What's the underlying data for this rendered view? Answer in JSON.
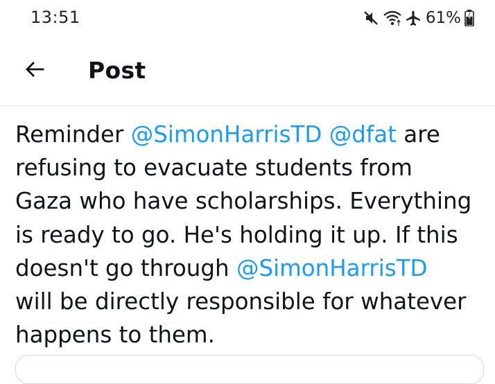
{
  "status_bar": {
    "time": "13:51",
    "battery_percent": "61%",
    "icons": [
      "mute-icon",
      "wifi-icon",
      "airplane-mode-icon",
      "battery-icon"
    ]
  },
  "header": {
    "title": "Post",
    "back_icon": "arrow-left-icon"
  },
  "tweet": {
    "lines": [
      [
        {
          "text": "Reminder ",
          "mention": false
        },
        {
          "text": "@SimonHarrisTD",
          "mention": true
        },
        {
          "text": " ",
          "mention": false
        },
        {
          "text": "@dfat",
          "mention": true
        },
        {
          "text": " are",
          "mention": false
        }
      ],
      [
        {
          "text": "refusing to evacuate students from",
          "mention": false
        }
      ],
      [
        {
          "text": "Gaza who have scholarships. Everything",
          "mention": false
        }
      ],
      [
        {
          "text": "is ready to go. He's holding it up. If this",
          "mention": false
        }
      ],
      [
        {
          "text": "doesn't go through ",
          "mention": false
        },
        {
          "text": "@SimonHarrisTD",
          "mention": true
        }
      ],
      [
        {
          "text": "will be directly responsible for whatever",
          "mention": false
        }
      ],
      [
        {
          "text": "happens to them.",
          "mention": false
        }
      ]
    ]
  },
  "colors": {
    "text": "#0f1419",
    "mention": "#1d9bf0",
    "divider": "#e6e9eb",
    "card_border": "#cfd9de"
  }
}
